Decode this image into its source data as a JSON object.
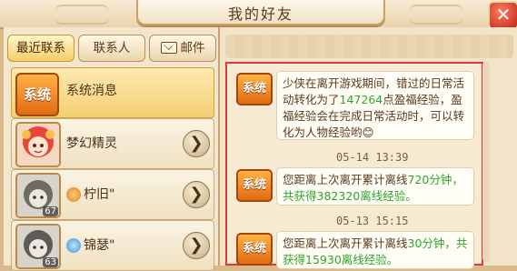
{
  "window": {
    "title": "我的好友",
    "close_label": "✕"
  },
  "tabs": [
    {
      "label": "最近联系",
      "active": true
    },
    {
      "label": "联系人",
      "active": false
    },
    {
      "label": "邮件",
      "active": false
    }
  ],
  "contacts": [
    {
      "badge": "系统",
      "name": "系统消息",
      "level": ""
    },
    {
      "name": "梦幻精灵",
      "level": ""
    },
    {
      "name": "柠旧\"",
      "level": "67"
    },
    {
      "name": "锦瑟\"",
      "level": "63"
    }
  ],
  "messages": [
    {
      "badge": "系统",
      "text_1": "少侠在离开游戏期间，错过的日常活动转化为了",
      "num_1": "147264",
      "text_2": "点盈福经验，盈福经验会在完成日常活动时，可以转化为人物经验哟",
      "emoticon": "😊"
    },
    {
      "time": "05-14  13:39",
      "badge": "系统",
      "text_1": "您距离上次离开累计离线",
      "num_1": "720分钟",
      "text_2": "，共获得",
      "num_2": "382320",
      "text_3": "离线经验。"
    },
    {
      "time": "05-13  15:15",
      "badge": "系统",
      "text_1": "您距离上次离开累计离线",
      "num_1": "30分钟",
      "text_2": "，共获得",
      "num_2": "15930",
      "text_3": "离线经验。"
    }
  ],
  "colors": {
    "accent_orange": "#e26b12",
    "highlight_green": "#2ea52a",
    "selection_border": "#e0373a"
  }
}
